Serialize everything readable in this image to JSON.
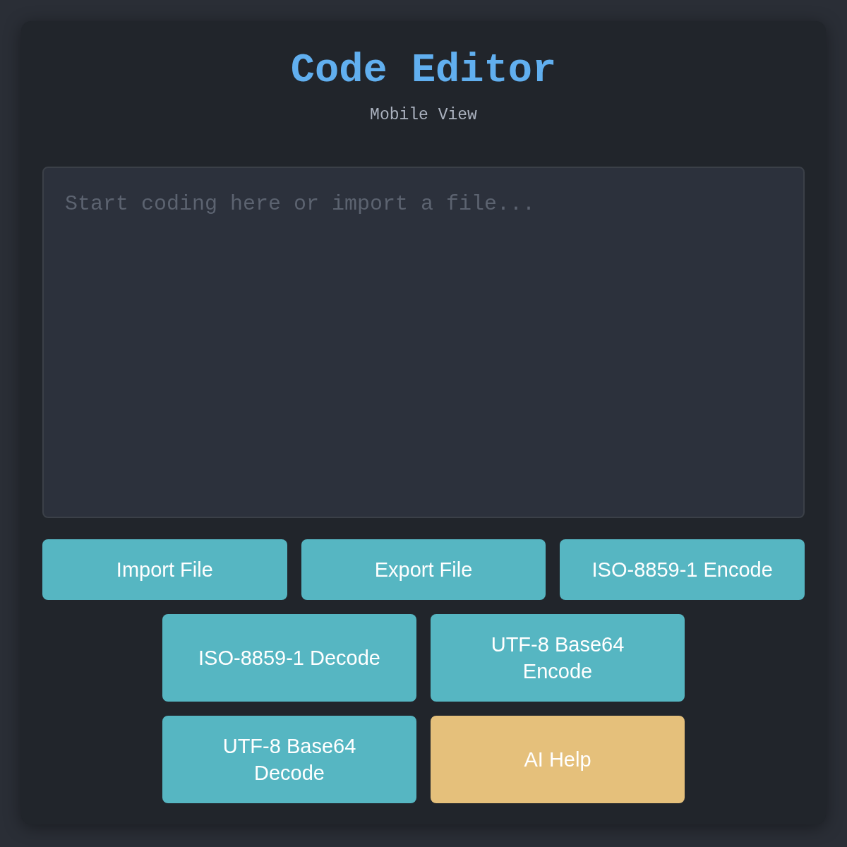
{
  "header": {
    "title": "Code Editor",
    "subtitle": "Mobile View"
  },
  "editor": {
    "placeholder": "Start coding here or import a file..."
  },
  "button_rows": [
    [
      {
        "label": "Import File",
        "kind": "action"
      },
      {
        "label": "Export File",
        "kind": "action"
      },
      {
        "label": "ISO-8859-1 Encode",
        "kind": "action"
      }
    ],
    [
      {
        "label": "ISO-8859-1 Decode",
        "kind": "action"
      },
      {
        "label": "UTF-8 Base64 Encode",
        "kind": "action"
      }
    ],
    [
      {
        "label": "UTF-8 Base64 Decode",
        "kind": "action"
      },
      {
        "label": "AI Help",
        "kind": "help"
      }
    ]
  ]
}
